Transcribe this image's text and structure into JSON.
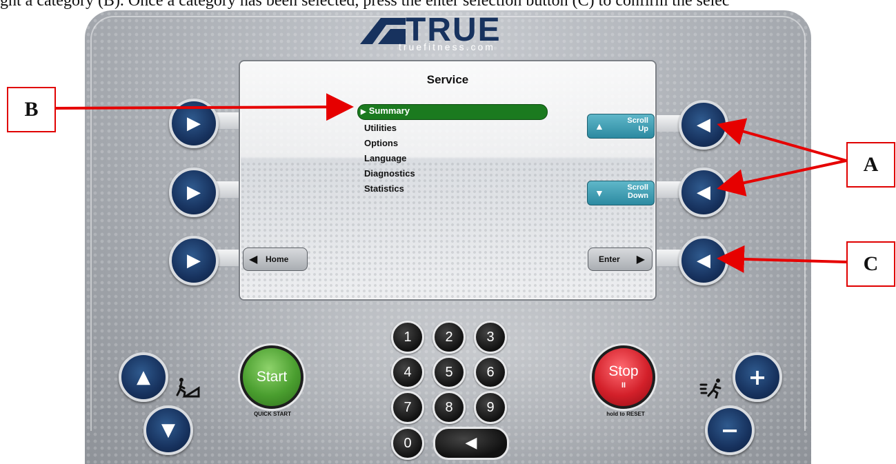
{
  "caption": "ght a category (B). Once a category has been selected, press the enter selection button (C) to confirm the selec",
  "logo": {
    "brand": "TRUE",
    "url": "truefitness.com"
  },
  "screen": {
    "title": "Service",
    "menu": [
      "Summary",
      "Utilities",
      "Options",
      "Language",
      "Diagnostics",
      "Statistics"
    ],
    "selected_index": 0,
    "scroll_up": {
      "line1": "Scroll",
      "line2": "Up"
    },
    "scroll_down": {
      "line1": "Scroll",
      "line2": "Down"
    },
    "home_label": "Home",
    "enter_label": "Enter"
  },
  "annotations": {
    "a": "A",
    "b": "B",
    "c": "C"
  },
  "keypad": [
    "1",
    "2",
    "3",
    "4",
    "5",
    "6",
    "7",
    "8",
    "9",
    "0"
  ],
  "controls": {
    "start_label": "Start",
    "start_sub": "QUICK START",
    "stop_label": "Stop",
    "stop_glyph": "II",
    "stop_sub": "hold to RESET"
  },
  "colors": {
    "highlight": "#1b7a1f",
    "soft_button": "#2c8aa1",
    "navy_key": "#17325e",
    "annotation_red": "#e00000",
    "start_green": "#4a9e2f",
    "stop_red": "#d3202a"
  },
  "icons": {
    "left_keys": "play-right-icon",
    "right_keys": "play-left-icon",
    "incline": "incline-icon",
    "speed": "speed-runner-icon"
  }
}
